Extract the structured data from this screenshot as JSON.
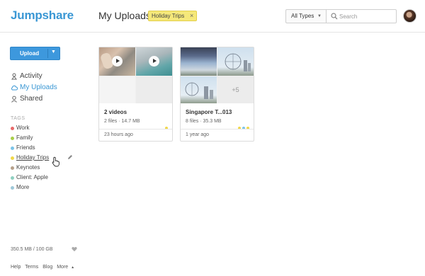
{
  "header": {
    "logo": "Jumpshare",
    "title": "My Uploads",
    "filter_tag": "Holiday Trips",
    "filter_remove": "×",
    "type_select": "All Types",
    "search_placeholder": "Search"
  },
  "sidebar": {
    "upload_label": "Upload",
    "nav": [
      {
        "label": "Activity",
        "icon": "activity-icon",
        "active": false
      },
      {
        "label": "My Uploads",
        "icon": "cloud-icon",
        "active": true
      },
      {
        "label": "Shared",
        "icon": "person-icon",
        "active": false
      }
    ],
    "tags_heading": "TAGS",
    "tags": [
      {
        "label": "Work",
        "color": "#e86b6b"
      },
      {
        "label": "Family",
        "color": "#a9cf4a"
      },
      {
        "label": "Friends",
        "color": "#7cc4e8"
      },
      {
        "label": "Holiday Trips",
        "color": "#f0d84a"
      },
      {
        "label": "Keynotes",
        "color": "#b6a08a"
      },
      {
        "label": "Client: Apple",
        "color": "#8fd0c0"
      },
      {
        "label": "More",
        "color": "#9ec8d8"
      }
    ],
    "storage": "350.5 MB / 100 GB",
    "footer": [
      "Help",
      "Terms",
      "Blog",
      "More"
    ]
  },
  "cards": [
    {
      "title": "2 videos",
      "meta": "2 files · 14.7 MB",
      "time": "23 hours ago",
      "tag_colors": [
        "#f0d84a"
      ]
    },
    {
      "title": "Singapore T...013",
      "meta": "8 files · 35.3 MB",
      "time": "1 year ago",
      "more_count": "+5",
      "tag_colors": [
        "#f0d84a",
        "#7cc4e8",
        "#f0d84a"
      ]
    }
  ],
  "colors": {
    "accent": "#3a97d4",
    "upload_button": "#3d98dd",
    "filter_tag_bg": "#f5e87a"
  }
}
